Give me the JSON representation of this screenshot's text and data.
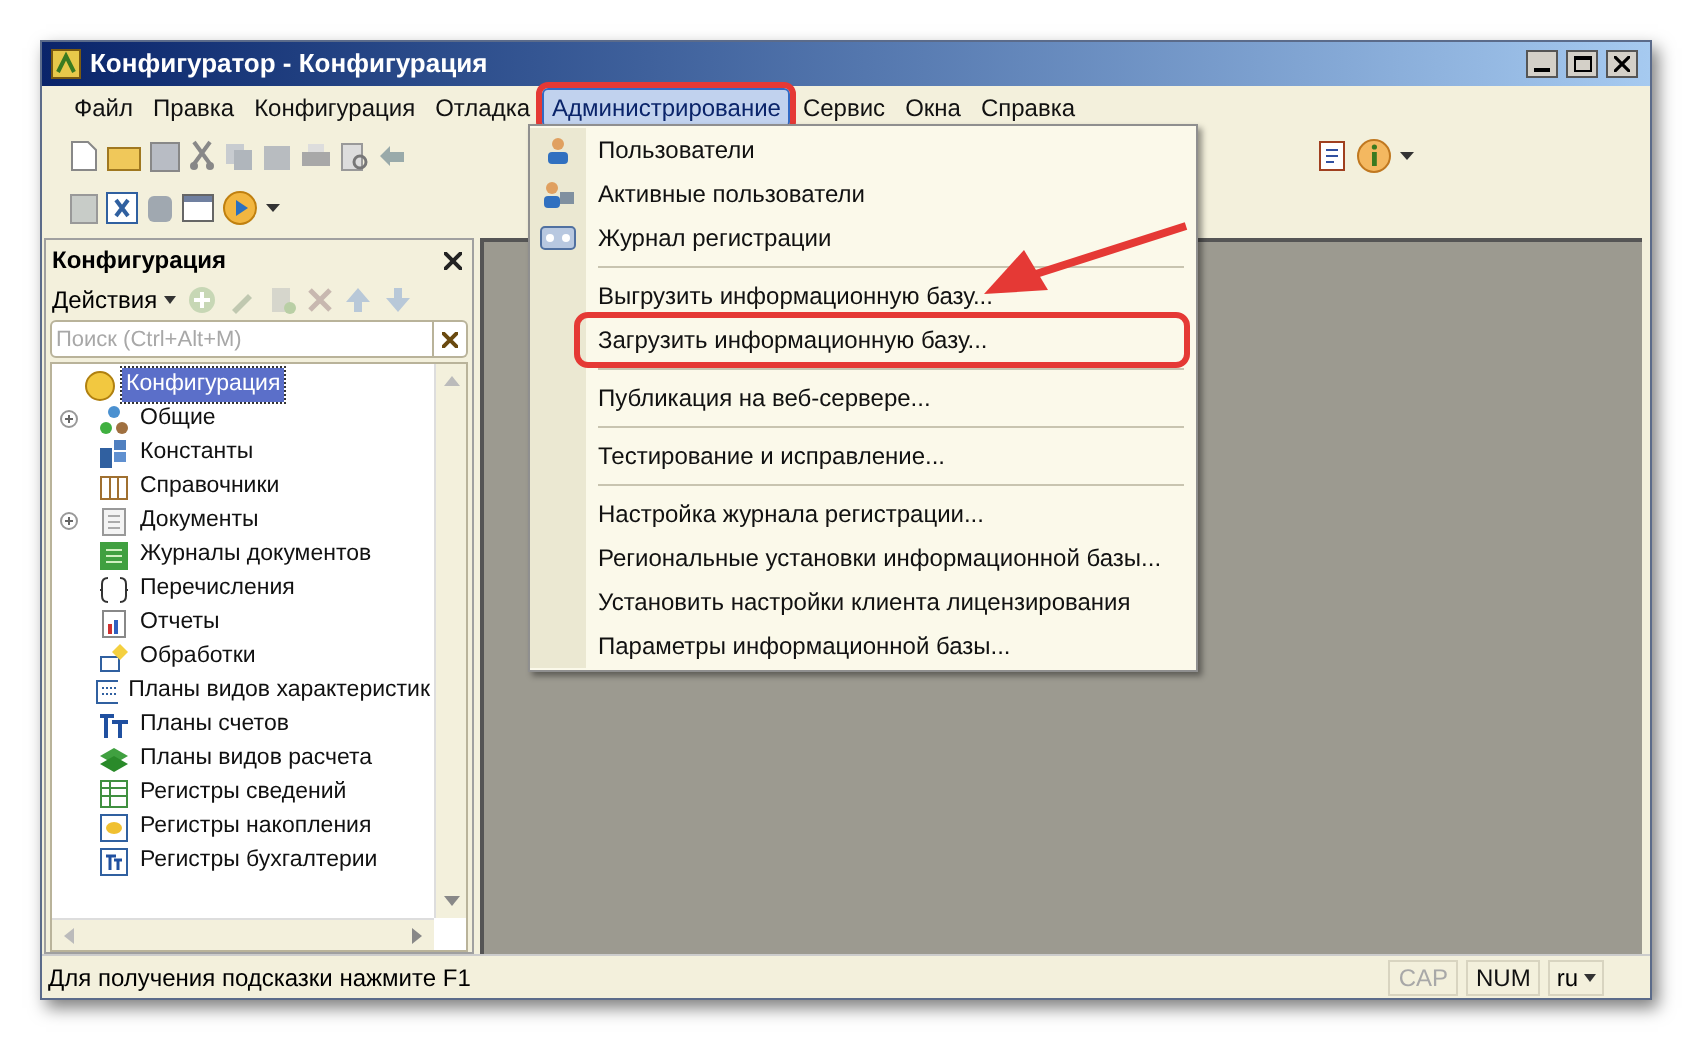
{
  "window": {
    "title": "Конфигуратор - Конфигурация"
  },
  "menu": [
    {
      "label": "Файл",
      "selected": false
    },
    {
      "label": "Правка",
      "selected": false
    },
    {
      "label": "Конфигурация",
      "selected": false
    },
    {
      "label": "Отладка",
      "selected": false
    },
    {
      "label": "Администрирование",
      "selected": true
    },
    {
      "label": "Сервис",
      "selected": false
    },
    {
      "label": "Окна",
      "selected": false
    },
    {
      "label": "Справка",
      "selected": false
    }
  ],
  "dropdown": [
    {
      "label": "Пользователи",
      "highlighted": false,
      "separator_before": false
    },
    {
      "label": "Активные пользователи",
      "highlighted": false,
      "separator_before": false
    },
    {
      "label": "Журнал регистрации",
      "highlighted": false,
      "separator_before": false
    },
    {
      "label": "Выгрузить информационную базу...",
      "highlighted": false,
      "separator_before": true
    },
    {
      "label": "Загрузить информационную базу...",
      "highlighted": true,
      "separator_before": false
    },
    {
      "label": "Публикация на веб-сервере...",
      "highlighted": false,
      "separator_before": true
    },
    {
      "label": "Тестирование и исправление...",
      "highlighted": false,
      "separator_before": true
    },
    {
      "label": "Настройка журнала регистрации...",
      "highlighted": false,
      "separator_before": true
    },
    {
      "label": "Региональные установки информационной базы...",
      "highlighted": false,
      "separator_before": false
    },
    {
      "label": "Установить настройки клиента лицензирования",
      "highlighted": false,
      "separator_before": false
    },
    {
      "label": "Параметры информационной базы...",
      "highlighted": false,
      "separator_before": false
    }
  ],
  "panel": {
    "title": "Конфигурация",
    "actions": "Действия",
    "search": {
      "placeholder": "Поиск (Ctrl+Alt+M)"
    },
    "tree": [
      {
        "label": "Конфигурация",
        "selected": true,
        "expandable": false
      },
      {
        "label": "Общие",
        "selected": false,
        "expandable": true
      },
      {
        "label": "Константы",
        "selected": false,
        "expandable": false
      },
      {
        "label": "Справочники",
        "selected": false,
        "expandable": false
      },
      {
        "label": "Документы",
        "selected": false,
        "expandable": true
      },
      {
        "label": "Журналы документов",
        "selected": false,
        "expandable": false
      },
      {
        "label": "Перечисления",
        "selected": false,
        "expandable": false
      },
      {
        "label": "Отчеты",
        "selected": false,
        "expandable": false
      },
      {
        "label": "Обработки",
        "selected": false,
        "expandable": false
      },
      {
        "label": "Планы видов характеристик",
        "selected": false,
        "expandable": false
      },
      {
        "label": "Планы счетов",
        "selected": false,
        "expandable": false
      },
      {
        "label": "Планы видов расчета",
        "selected": false,
        "expandable": false
      },
      {
        "label": "Регистры сведений",
        "selected": false,
        "expandable": false
      },
      {
        "label": "Регистры накопления",
        "selected": false,
        "expandable": false
      },
      {
        "label": "Регистры бухгалтерии",
        "selected": false,
        "expandable": false
      }
    ]
  },
  "status_bar": {
    "hint": "Для получения подсказки нажмите F1",
    "indicators": [
      {
        "label": "CAP",
        "on": false
      },
      {
        "label": "NUM",
        "on": true
      }
    ],
    "language": "ru"
  }
}
